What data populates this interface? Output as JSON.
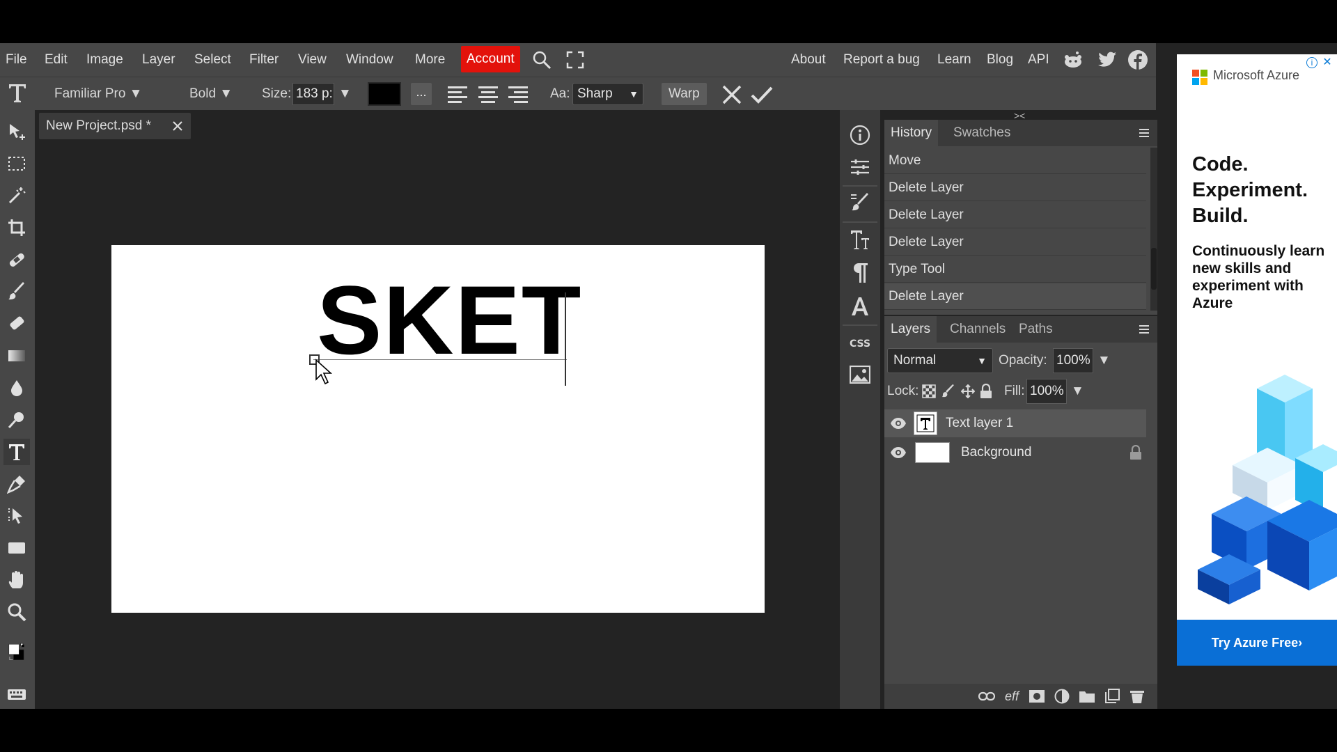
{
  "menubar": {
    "items": [
      "File",
      "Edit",
      "Image",
      "Layer",
      "Select",
      "Filter",
      "View",
      "Window",
      "More"
    ],
    "account_label": "Account",
    "right_links": [
      "About",
      "Report a bug",
      "Learn",
      "Blog",
      "API"
    ]
  },
  "options": {
    "font_family": "Familiar Pro",
    "font_weight": "Bold",
    "size_label": "Size:",
    "size_value": "183 p:",
    "more_label": "...",
    "antialias_label": "Aa:",
    "antialias_value": "Sharp",
    "warp_label": "Warp",
    "text_color": "#000000"
  },
  "document": {
    "tab_title": "New Project.psd *",
    "canvas_text": "SKET"
  },
  "history": {
    "tabs": [
      "History",
      "Swatches"
    ],
    "items": [
      "Move",
      "Delete Layer",
      "Delete Layer",
      "Delete Layer",
      "Type Tool",
      "Delete Layer"
    ]
  },
  "layers": {
    "tabs": [
      "Layers",
      "Channels",
      "Paths"
    ],
    "blend_mode": "Normal",
    "opacity_label": "Opacity:",
    "opacity_value": "100%",
    "lock_label": "Lock:",
    "fill_label": "Fill:",
    "fill_value": "100%",
    "items": [
      {
        "name": "Text layer 1"
      },
      {
        "name": "Background"
      }
    ]
  },
  "strip": {
    "css_label": "CSS"
  },
  "ad": {
    "brand": "Microsoft Azure",
    "headline_lines": [
      "Code.",
      "Experiment.",
      "Build."
    ],
    "body": "Continuously learn new skills and experiment with Azure",
    "cta": "Try Azure Free›"
  },
  "colors": {
    "accent": "#e3120b",
    "panel": "#474747",
    "workspace": "#232323",
    "ad_blue": "#0a6fd6"
  }
}
